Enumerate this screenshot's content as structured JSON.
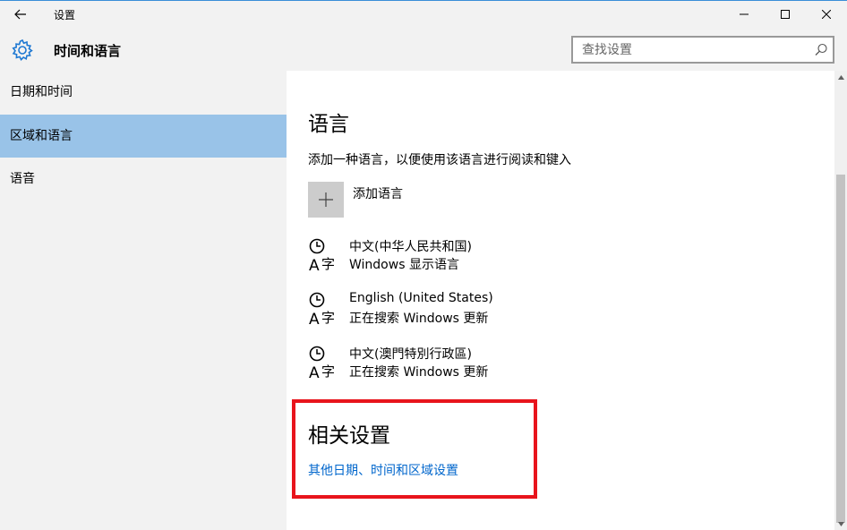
{
  "window": {
    "title": "设置",
    "icons": {
      "back": "back-arrow-icon",
      "minimize": "minimize-icon",
      "maximize": "maximize-icon",
      "close": "close-icon"
    }
  },
  "header": {
    "title": "时间和语言",
    "icon": "gear-icon",
    "search_placeholder": "查找设置"
  },
  "sidebar": {
    "items": [
      {
        "label": "日期和时间",
        "selected": false
      },
      {
        "label": "区域和语言",
        "selected": true
      },
      {
        "label": "语音",
        "selected": false
      }
    ]
  },
  "content": {
    "language_heading": "语言",
    "language_description": "添加一种语言，以便使用该语言进行阅读和键入",
    "add_language_label": "添加语言",
    "languages": [
      {
        "name": "中文(中华人民共和国)",
        "status": "Windows 显示语言"
      },
      {
        "name": "English (United States)",
        "status": "正在搜索 Windows 更新"
      },
      {
        "name": "中文(澳門特別行政區)",
        "status": "正在搜索 Windows 更新"
      }
    ],
    "related_heading": "相关设置",
    "related_link": "其他日期、时间和区域设置"
  },
  "colors": {
    "accent": "#3a8ed8",
    "selected_item": "#99c3e8",
    "link": "#0066cc",
    "highlight_box": "#e8141c"
  }
}
